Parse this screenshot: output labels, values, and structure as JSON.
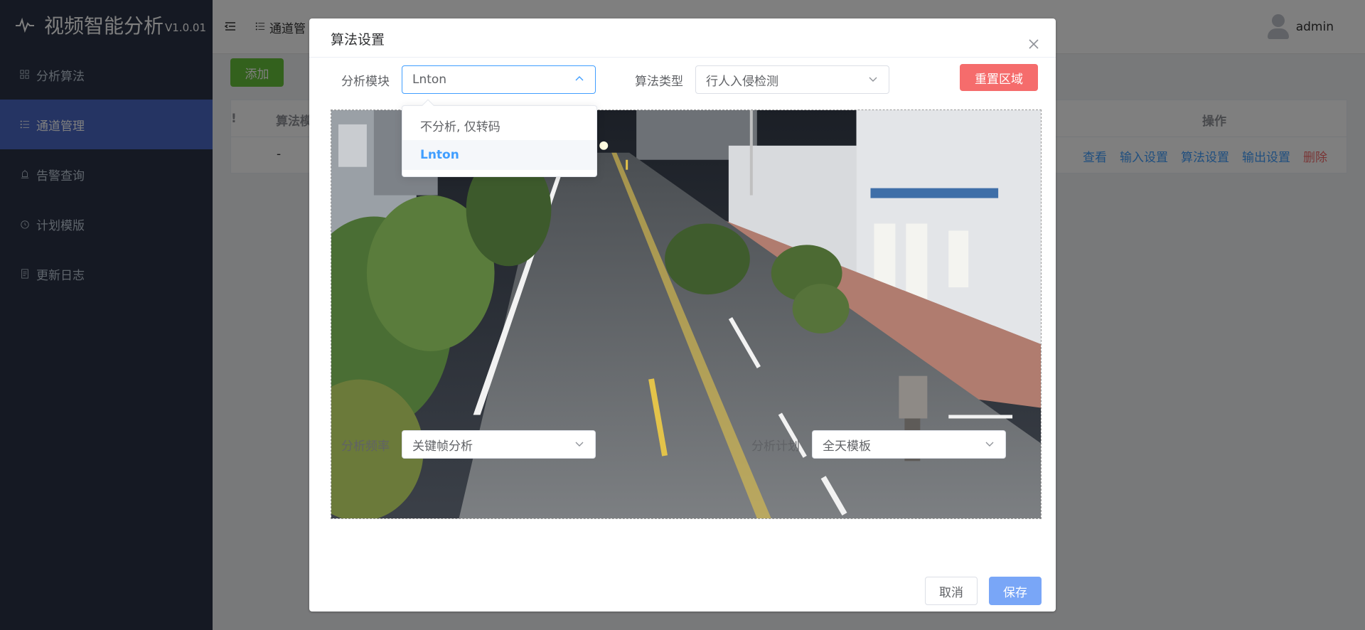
{
  "app": {
    "title": "视频智能分析",
    "version": "V1.0.01"
  },
  "sidebar": {
    "items": [
      {
        "label": "分析算法",
        "icon": "grid-icon",
        "active": false
      },
      {
        "label": "通道管理",
        "icon": "list-icon",
        "active": true
      },
      {
        "label": "告警查询",
        "icon": "alarm-icon",
        "active": false
      },
      {
        "label": "计划模版",
        "icon": "clock-icon",
        "active": false
      },
      {
        "label": "更新日志",
        "icon": "document-icon",
        "active": false
      }
    ]
  },
  "header": {
    "breadcrumb": "通道管",
    "user": "admin"
  },
  "main": {
    "add_label": "添加",
    "table": {
      "headers": {
        "partial": "!",
        "algo": "算法模",
        "ops": "操作"
      },
      "row": {
        "algo": "-",
        "ops": [
          "查看",
          "输入设置",
          "算法设置",
          "输出设置",
          "删除"
        ]
      }
    }
  },
  "dialog": {
    "title": "算法设置",
    "module": {
      "label": "分析模块",
      "value": "Lnton",
      "options": [
        "不分析, 仅转码",
        "Lnton"
      ],
      "selected": "Lnton"
    },
    "algo_type": {
      "label": "算法类型",
      "value": "行人入侵检测"
    },
    "reset_label": "重置区域",
    "frequency": {
      "label": "分析频率",
      "value": "关键帧分析"
    },
    "plan": {
      "label": "分析计划",
      "value": "全天模板"
    },
    "cancel_label": "取消",
    "save_label": "保存"
  },
  "colors": {
    "sidebar_bg": "#2b3346",
    "sidebar_active": "#4a69c6",
    "primary": "#409eff",
    "danger": "#f56c6c",
    "success": "#67c23a",
    "save_button": "#79a6f7"
  }
}
